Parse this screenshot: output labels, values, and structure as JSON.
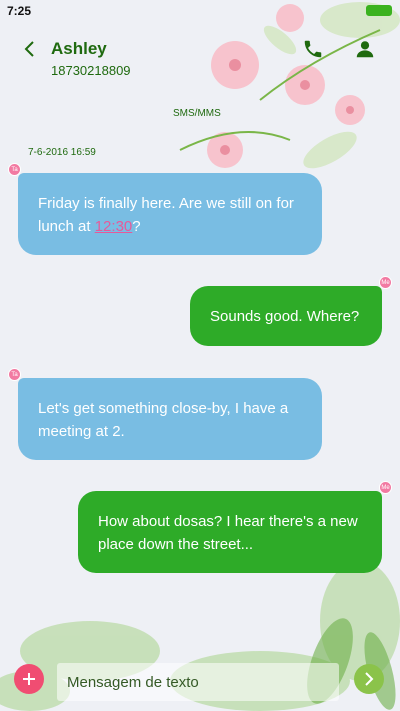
{
  "status_bar": {
    "time": "7:25"
  },
  "header": {
    "name": "Ashley",
    "number": "18730218809"
  },
  "thread": {
    "channel_label": "SMS/MMS",
    "date": "7-6-2016 16:59"
  },
  "messages": [
    {
      "direction": "incoming",
      "text_before": "Friday is finally here. Are we still on for lunch at ",
      "link": "12:30",
      "text_after": "?"
    },
    {
      "direction": "outgoing",
      "text": "Sounds good. Where?"
    },
    {
      "direction": "incoming",
      "text": "Let's get something close-by, I have a meeting at 2."
    },
    {
      "direction": "outgoing",
      "text": "How about dosas? I hear there's a new place down the street..."
    }
  ],
  "avatars": {
    "incoming": "Ta",
    "outgoing": "Me"
  },
  "composer": {
    "placeholder": "Mensagem de texto"
  },
  "colors": {
    "incoming_bubble": "#79bde3",
    "outgoing_bubble": "#2eab28",
    "accent_green": "#1f6a0f",
    "add_button": "#f04d72",
    "send_button": "#8bc34a"
  }
}
